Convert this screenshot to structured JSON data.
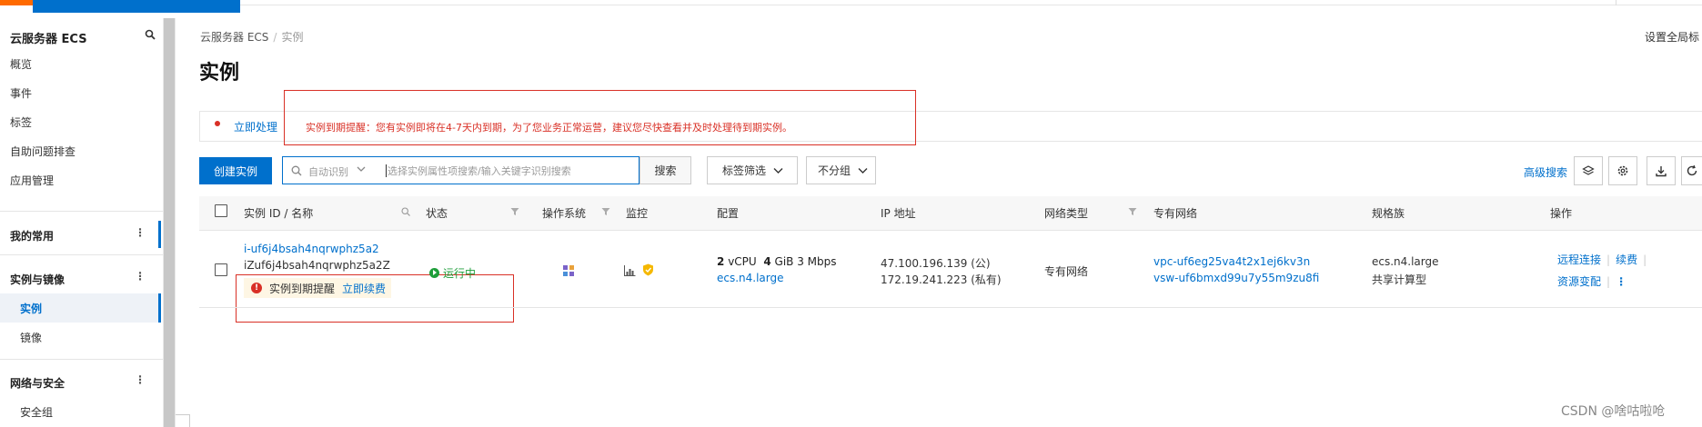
{
  "sidebar": {
    "title": "云服务器 ECS",
    "items": [
      "概览",
      "事件",
      "标签",
      "自助问题排查",
      "应用管理"
    ],
    "groups": {
      "favorites": "我的常用",
      "instances_images": "实例与镜像",
      "instances": "实例",
      "images": "镜像",
      "network_security": "网络与安全",
      "security_groups": "安全组"
    }
  },
  "header": {
    "breadcrumb": [
      "云服务器 ECS",
      "实例"
    ],
    "title": "实例",
    "global_settings": "设置全局标"
  },
  "alert": {
    "action": "立即处理",
    "message": "实例到期提醒：您有实例即将在4-7天内到期，为了您业务正常运营，建议您尽快查看并及时处理待到期实例。"
  },
  "toolbar": {
    "create": "创建实例",
    "search_mode": "自动识别",
    "search_placeholder": "选择实例属性项搜索/输入关键字识别搜索",
    "search": "搜索",
    "tag_filter": "标签筛选",
    "group": "不分组",
    "advanced_search": "高级搜索"
  },
  "table": {
    "headers": {
      "id_name": "实例 ID / 名称",
      "status": "状态",
      "os": "操作系统",
      "monitor": "监控",
      "config": "配置",
      "ip": "IP 地址",
      "network_type": "网络类型",
      "vpc": "专有网络",
      "family": "规格族",
      "actions": "操作"
    },
    "rows": [
      {
        "id": "i-uf6j4bsah4nqrwphz5a2",
        "name": "iZuf6j4bsah4nqrwphz5a2Z",
        "expire_tag": "实例到期提醒",
        "renew_link": "立即续费",
        "status": "运行中",
        "vcpu_num": "2",
        "vcpu_unit": "vCPU",
        "mem_num": "4",
        "mem_rest": "GiB 3 Mbps",
        "spec": "ecs.n4.large",
        "ip_public": "47.100.196.139 (公)",
        "ip_private": "172.19.241.223 (私有)",
        "network_type": "专有网络",
        "vpc": "vpc-uf6eg25va4t2x1ej6kv3n",
        "vswitch": "vsw-uf6bmxd99u7y55m9zu8fi",
        "family_spec": "ecs.n4.large",
        "family_name": "共享计算型",
        "action_remote": "远程连接",
        "action_renew": "续费",
        "action_change": "资源变配"
      }
    ]
  },
  "watermark": "CSDN @啥咕啦呛",
  "colors": {
    "primary": "#0070cc",
    "danger": "#d93026",
    "running": "#1e9e3a",
    "brand_orange": "#ff6a00"
  }
}
